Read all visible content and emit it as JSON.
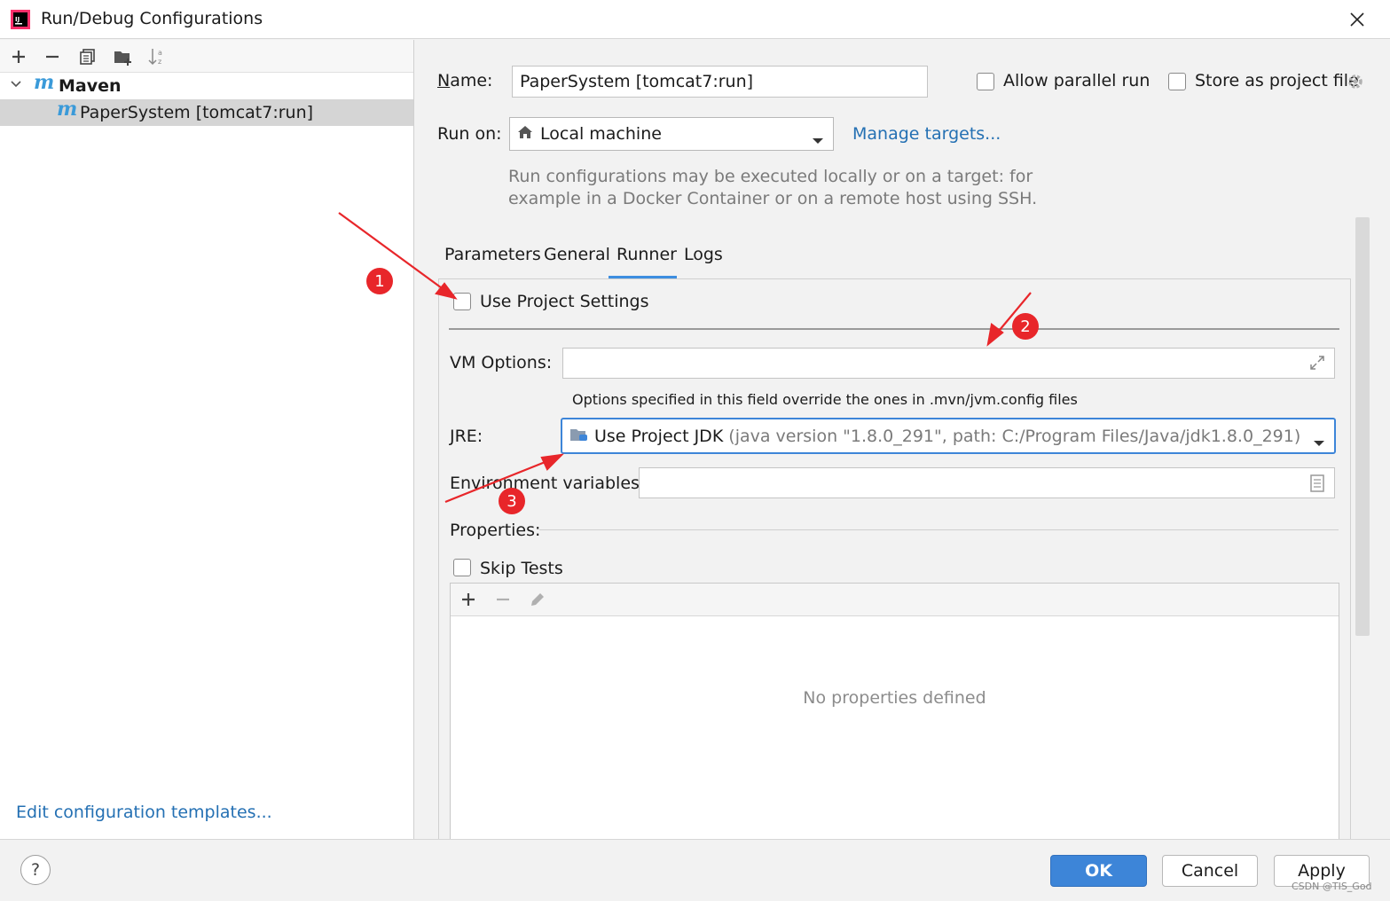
{
  "window": {
    "title": "Run/Debug Configurations"
  },
  "toolbar": {
    "icons": [
      "plus-icon",
      "minus-icon",
      "copy-icon",
      "folder-add-icon",
      "sort-az-icon"
    ]
  },
  "tree": {
    "group_label": "Maven",
    "item_label": "PaperSystem [tomcat7:run]"
  },
  "left_footer": {
    "edit_templates": "Edit configuration templates..."
  },
  "form": {
    "name_label": "Name:",
    "name_value": "PaperSystem [tomcat7:run]",
    "allow_parallel_label": "Allow parallel run",
    "store_project_file_label": "Store as project file",
    "run_on_label": "Run on:",
    "run_on_value": "Local machine",
    "manage_targets": "Manage targets...",
    "run_on_hint_line1": "Run configurations may be executed locally or on a target: for",
    "run_on_hint_line2": "example in a Docker Container or on a remote host using SSH."
  },
  "tabs": [
    {
      "label": "Parameters",
      "active": false
    },
    {
      "label": "General",
      "active": false
    },
    {
      "label": "Runner",
      "active": true
    },
    {
      "label": "Logs",
      "active": false
    }
  ],
  "runner": {
    "use_project_settings_label": "Use Project Settings",
    "vm_options_label": "VM Options:",
    "vm_options_value": "",
    "vm_options_hint": "Options specified in this field override the ones in .mvn/jvm.config files",
    "jre_label": "JRE:",
    "jre_value_main": "Use Project JDK",
    "jre_value_detail": "(java version \"1.8.0_291\", path: C:/Program Files/Java/jdk1.8.0_291)",
    "env_vars_label": "Environment variables:",
    "env_vars_value": "",
    "properties_label": "Properties:",
    "skip_tests_label": "Skip Tests",
    "no_properties": "No properties defined"
  },
  "annotations": {
    "badge1": "1",
    "badge2": "2",
    "badge3": "3"
  },
  "buttons": {
    "ok": "OK",
    "cancel": "Cancel",
    "apply": "Apply"
  },
  "watermark": "CSDN @TIS_God",
  "colors": {
    "accent": "#3d85d8",
    "link": "#2470b3",
    "annotation": "#e8262a"
  }
}
